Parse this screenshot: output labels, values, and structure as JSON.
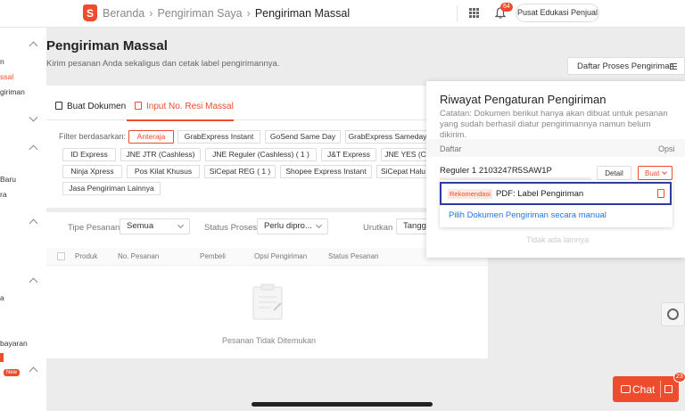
{
  "topbar": {
    "logo": "S",
    "breadcrumb": [
      "Beranda",
      "Pengiriman Saya",
      "Pengiriman Massal"
    ],
    "bell_badge": "64",
    "edu_button": "Pusat Edukasi Penjual"
  },
  "sidebar": {
    "items": [
      "n",
      "ssal",
      "giriman",
      "Baru",
      "ra",
      "a",
      "bayaran"
    ],
    "new_badge": "New"
  },
  "page": {
    "title": "Pengiriman Massal",
    "subtitle": "Kirim pesanan Anda sekaligus dan cetak label pengirimannya.",
    "daftar_button": "Daftar Proses Pengiriman"
  },
  "tabs": [
    "Buat Dokumen",
    "Input No. Resi Massal"
  ],
  "filter": {
    "label": "Filter berdasarkan:",
    "chips": [
      "Anteraja",
      "GrabExpress Instant",
      "GoSend Same Day",
      "GrabExpress Sameday",
      "ID Express",
      "JNE JTR (Cashless)",
      "JNE Reguler (Cashless) ( 1 )",
      "J&T Express",
      "JNE YES (C",
      "Ninja Xpress",
      "Pos Kilat Khusus",
      "SiCepat REG ( 1 )",
      "Shopee Express Instant",
      "SiCepat Halu",
      "Jasa Pengiriman Lainnya"
    ],
    "selected": "Anteraja"
  },
  "controls": {
    "type_label": "Tipe Pesanan",
    "type_value": "Semua",
    "status_label": "Status Proses",
    "status_value": "Perlu dipro...",
    "sort_label": "Urutkan",
    "sort_value": "Tangga"
  },
  "table": {
    "columns": [
      "Produk",
      "No. Pesanan",
      "Pembeli",
      "Opsi Pengiriman",
      "Status Pesanan"
    ],
    "empty": "Pesanan Tidak Ditemukan"
  },
  "popover": {
    "title": "Riwayat Pengaturan Pengiriman",
    "note": "Catatan: Dokumen berikut hanya akan dibuat untuk pesanan yang sudah berhasil diatur pengirimannya namun belum dikirim.",
    "col_list": "Daftar",
    "col_options": "Opsi",
    "row_label": "Reguler 1 2103247R5SAW1P",
    "detail_button": "Detail",
    "buat_button": "Buat",
    "recommend_badge": "Rekomendasi",
    "recommend_label": "PDF: Label Pengiriman",
    "manual_link": "Pilih Dokumen Pengiriman secara manual",
    "no_more": "Tidak ada lainnya"
  },
  "chat": {
    "label": "Chat",
    "badge": "23"
  },
  "colors": {
    "brand": "#ee4d2d",
    "highlight_box": "#2f3a9e",
    "link": "#2673dd"
  }
}
